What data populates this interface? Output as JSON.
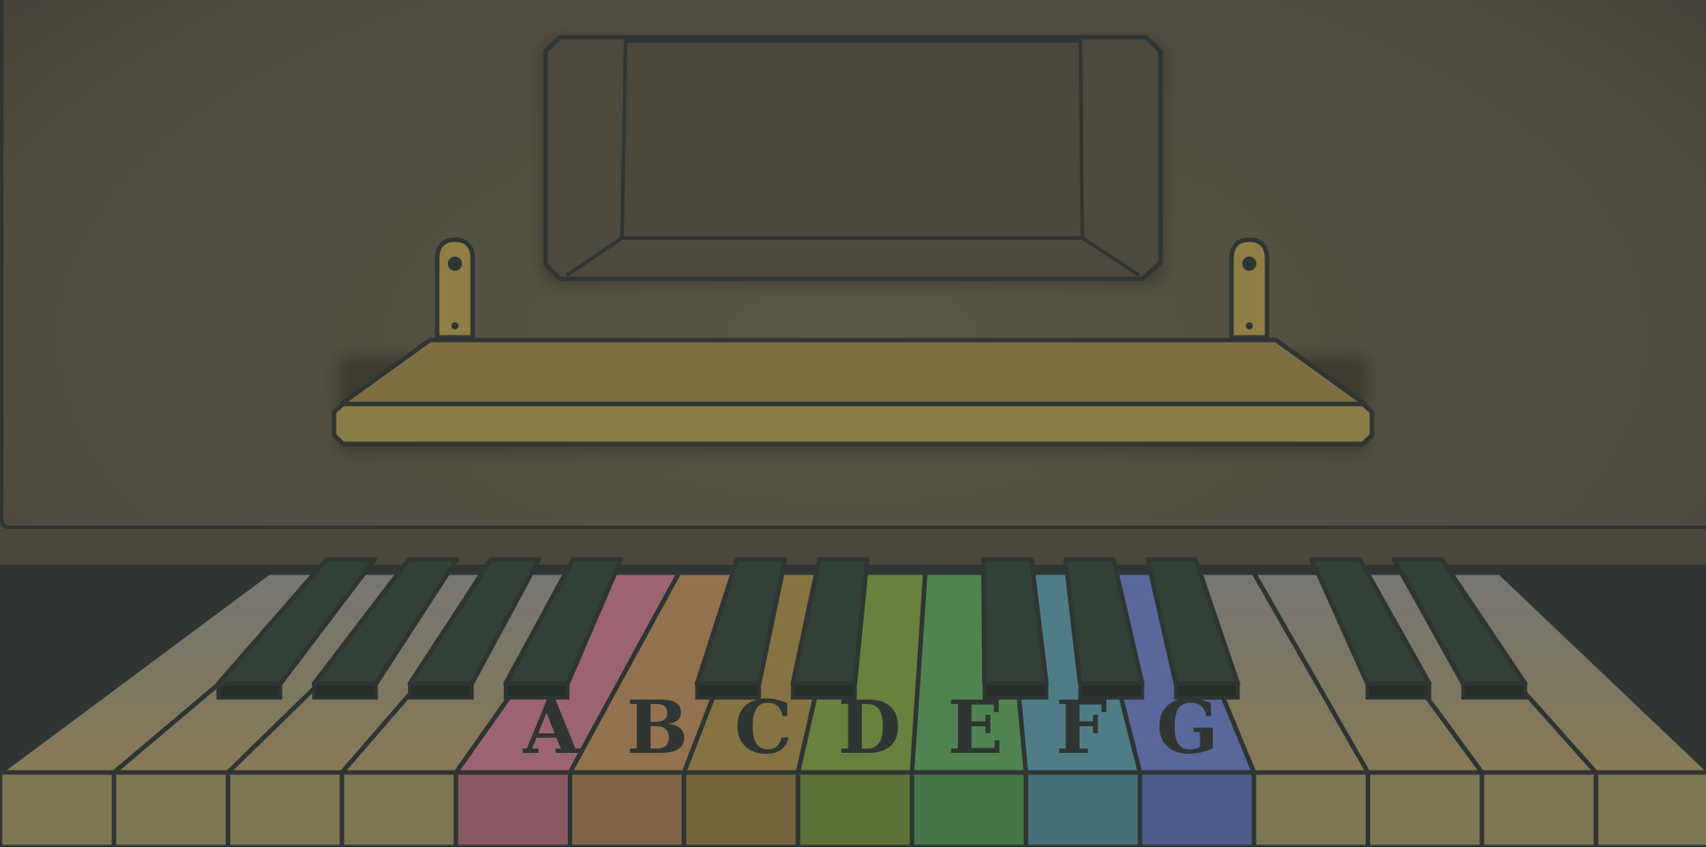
{
  "scene": {
    "type": "piano",
    "colors": {
      "wall": "#545141",
      "wall_dark": "#403e34",
      "outline": "#2f3533",
      "shelf": "#8a7c46",
      "shelf_top": "#7a6e42",
      "bracket": "#8f7f45",
      "white_key_top": "#7c7c76",
      "white_key_bottom": "#8a7d58",
      "black_key": "#324036"
    }
  },
  "music_board": {
    "icon": "blank-board-icon"
  },
  "keyboard": {
    "white_keys": [
      {
        "label": "",
        "color": null
      },
      {
        "label": "",
        "color": null
      },
      {
        "label": "",
        "color": null
      },
      {
        "label": "",
        "color": null
      },
      {
        "label": "A",
        "color": "#9b6470"
      },
      {
        "label": "B",
        "color": "#93714e"
      },
      {
        "label": "C",
        "color": "#857344"
      },
      {
        "label": "D",
        "color": "#69803f"
      },
      {
        "label": "E",
        "color": "#4f8451"
      },
      {
        "label": "F",
        "color": "#4f7d85"
      },
      {
        "label": "G",
        "color": "#5a679a"
      },
      {
        "label": "",
        "color": null
      },
      {
        "label": "",
        "color": null
      },
      {
        "label": "",
        "color": null
      },
      {
        "label": "",
        "color": null
      }
    ]
  }
}
